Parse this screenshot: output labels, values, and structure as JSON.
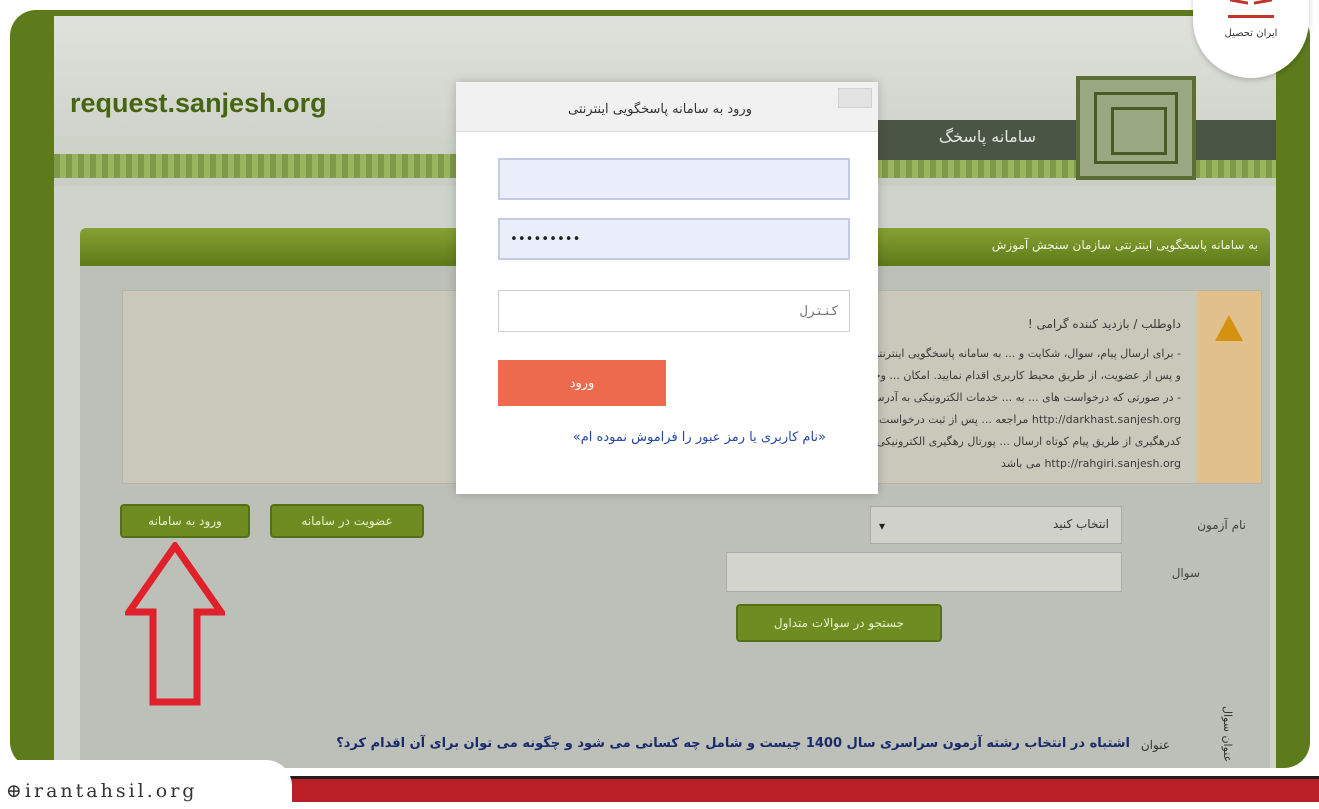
{
  "site": {
    "url": "request.sanjesh.org",
    "header_title": "سامانه پاسخگ",
    "nav_text": "به سامانه پاسخگویی اینترنتی سازمان سنجش آموزش"
  },
  "notice": {
    "greeting": "داوطلب / بازدید کننده گرامی !",
    "lines": [
      "- برای ارسال پیام، سوال، شکایت و ... به سامانه پاسخگویی اینترنتی (request.sanjesh.org - ضمن سامانه)",
      "و پس از عضویت، از طریق محیط کاربری اقدام نمایید. امکان ... وجود دارد.",
      "- در صورتی که درخواست های ... به ... خدمات الکترونیکی به آدرس:",
      "http://darkhast.sanjesh.org مراجعه ... پس از ثبت درخواست، برای داوطلب شماره نامه و",
      "کدرهگیری از طریق پیام کوتاه ارسال ... پورتال رهگیری الکترونیکی مکاتبات به آدرس:",
      "http://rahgiri.sanjesh.org می باشد"
    ]
  },
  "buttons": {
    "login_system": "ورود به سامانه",
    "register_system": "عضویت در سامانه",
    "search_faq": "جستجو در سوالات متداول"
  },
  "form": {
    "exam_label": "نام آزمون",
    "exam_selected": "انتخاب کنید",
    "question_label": "سوال"
  },
  "result": {
    "label": "عنوان",
    "title": "اشتباه در انتخاب رشته آزمون سراسری سال 1400 چیست و شامل چه کسانی می شود و چگونه می توان برای آن اقدام کرد؟",
    "vertical_label": "عنوان سوال"
  },
  "modal": {
    "title": "ورود به سامانه پاسخگویی اینترنتی",
    "password_value": "•••••••••",
    "captcha_placeholder": "کنترل",
    "login_label": "ورود",
    "forgot_link": "«نام کاربری یا رمز عبور را فراموش نموده ام»"
  },
  "brand": {
    "name": "ایران تحصیل",
    "watermark": "irantahsil.org"
  },
  "colors": {
    "frame_green": "#5d7a1c",
    "login_orange": "#ee6a4f",
    "arrow_red": "#e0202a",
    "brand_red": "#b91f24"
  }
}
